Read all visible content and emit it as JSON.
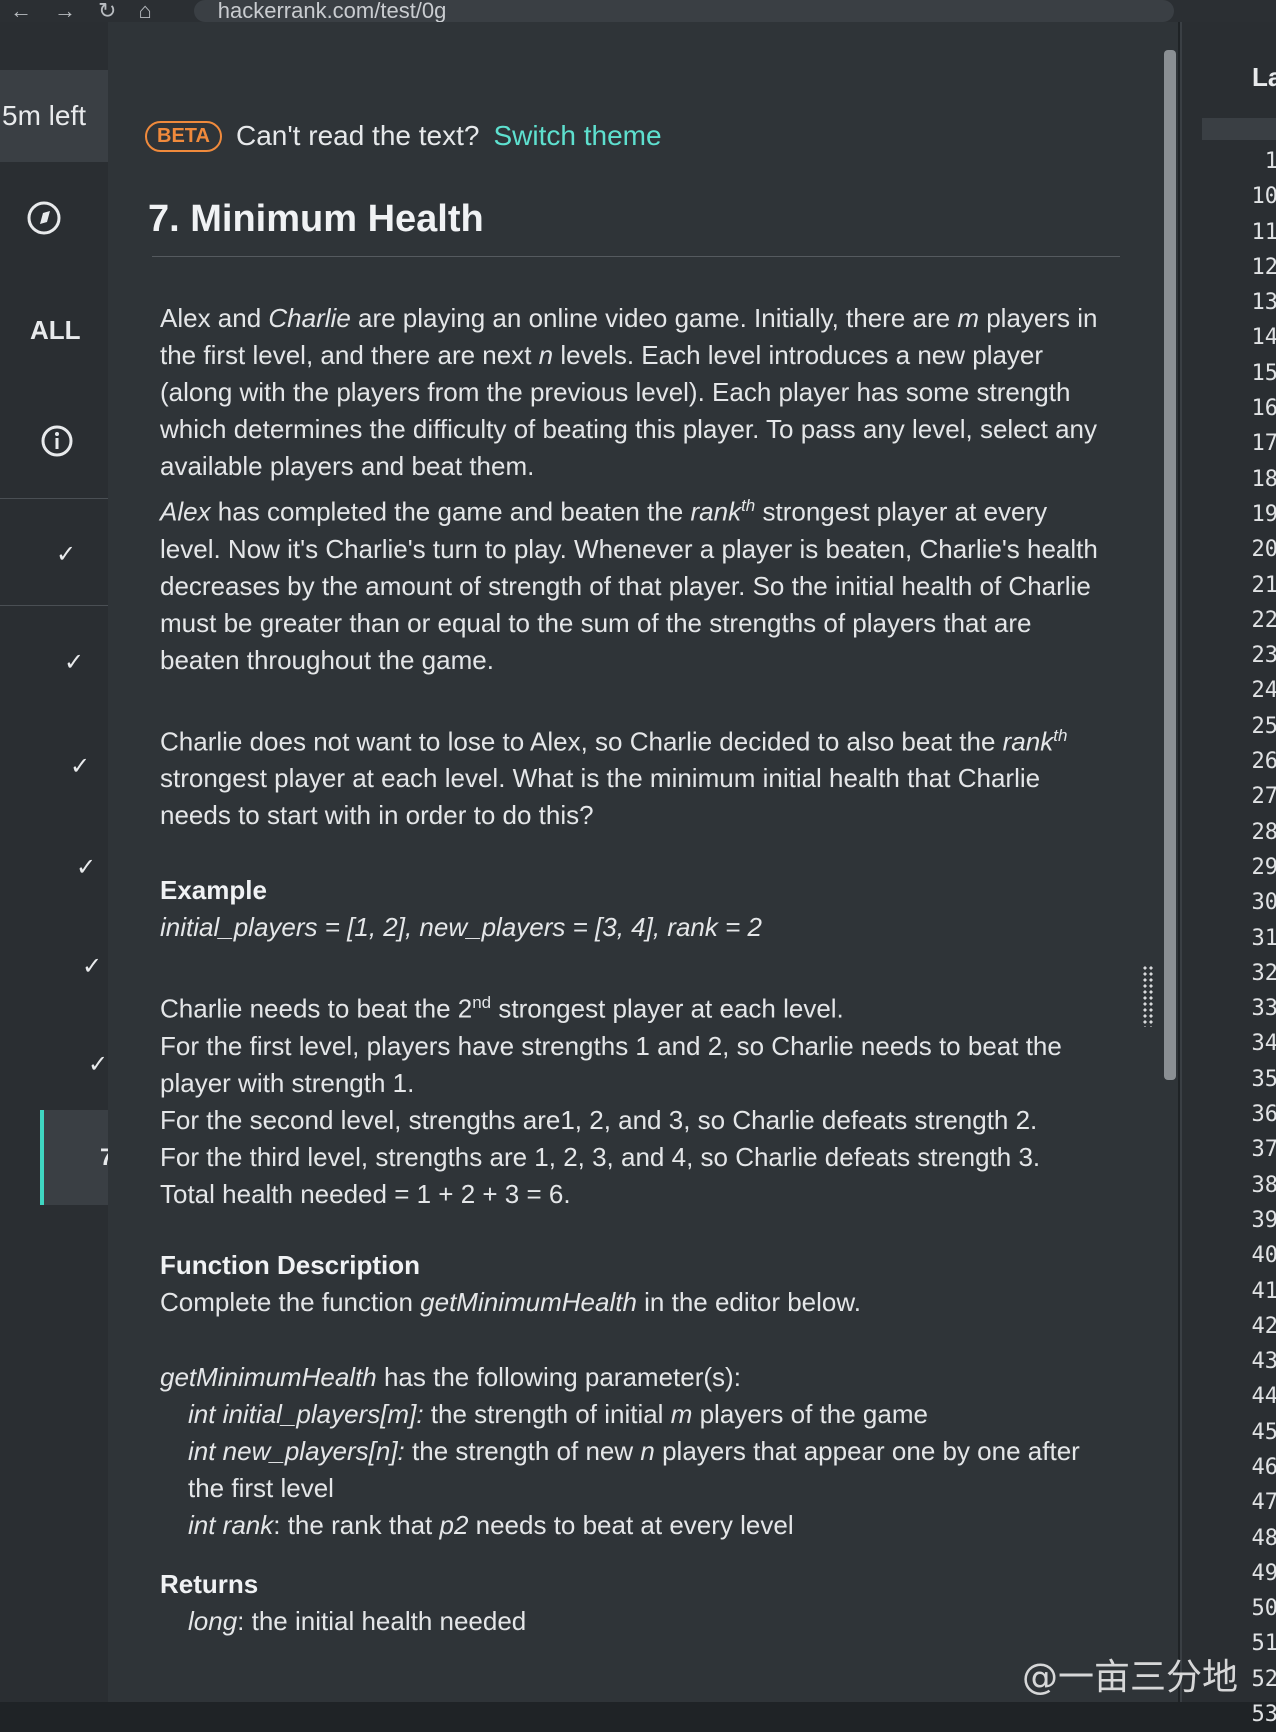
{
  "browser": {
    "url_fragment": "hackerrank.com/test/0g"
  },
  "nav": {
    "time_left": "5m left",
    "all_label": "ALL",
    "active_question": "7"
  },
  "banner": {
    "beta": "BETA",
    "prompt": "Can't read the text?",
    "switch_theme": "Switch theme"
  },
  "problem": {
    "title": "7. Minimum Health",
    "p1_a": "Alex and ",
    "p1_b": "Charlie",
    "p1_c": " are playing an online video game. Initially, there are ",
    "p1_m": "m",
    "p1_d": " players in the first level, and there are next ",
    "p1_n": "n",
    "p1_e": " levels. Each level introduces a new player (along with the players from the previous level). Each player has some strength which determines the difficulty of beating this player. To pass any level, select any available players and beat them.",
    "p2_alex": "Alex",
    "p2_a": " has completed the game and beaten the ",
    "p2_rank": "rank",
    "p2_th": "th",
    "p2_b": " strongest player at every level. Now it's Charlie's turn to play. Whenever a player is beaten, Charlie's health decreases by the amount of strength of that player. So the initial health of Charlie must be greater than or equal to the sum of the strengths of players that are beaten throughout the game.",
    "p3_a": "Charlie does not want to lose to Alex, so Charlie decided to also beat the ",
    "p3_rank": "rank",
    "p3_th": "th",
    "p3_b": " strongest player at each level. What is the minimum initial health that Charlie needs to start with in order to do this?",
    "example_head": "Example",
    "example_line": "initial_players = [1, 2], new_players = [3, 4], rank = 2",
    "ex1_a": "Charlie needs to beat the 2",
    "ex1_nd": "nd",
    "ex1_b": " strongest player at each level.",
    "ex2": "For the first level, players have strengths 1 and 2, so Charlie needs to beat the player with strength 1.",
    "ex3": "For the second level, strengths are1, 2, and 3, so Charlie defeats strength 2.",
    "ex4": "For the third level, strengths are 1, 2, 3, and 4, so Charlie defeats strength 3.",
    "ex5": "Total health needed = 1 + 2 + 3 = 6.",
    "func_head": "Function Description",
    "func_a": "Complete the function ",
    "func_name": "getMinimumHealth",
    "func_b": " in the editor below.",
    "params_name": "getMinimumHealth",
    "params_a": " has the following parameter(s):",
    "param1_sig": "int initial_players[m]:",
    "param1_a": "  the strength of initial ",
    "param1_m": "m",
    "param1_b": " players of the game",
    "param2_sig": "int new_players[n]:",
    "param2_a": "  the strength of new ",
    "param2_n": "n",
    "param2_b": " players that appear one by one after the first level",
    "param3_sig": "int rank",
    "param3_a": ": the rank that ",
    "param3_p2": "p2",
    "param3_b": " needs to beat at every level",
    "returns_head": "Returns",
    "returns_type": "long",
    "returns_desc": ": the initial health needed"
  },
  "editor": {
    "header_fragment": "La",
    "line_numbers": [
      "1",
      "10",
      "11",
      "12",
      "13",
      "14",
      "15",
      "16",
      "17",
      "18",
      "19",
      "20",
      "21",
      "22",
      "23",
      "24",
      "25",
      "26",
      "27",
      "28",
      "29",
      "30",
      "31",
      "32",
      "33",
      "34",
      "35",
      "36",
      "37",
      "38",
      "39",
      "40",
      "41",
      "42",
      "43",
      "44",
      "45",
      "46",
      "47",
      "48",
      "49",
      "50",
      "51",
      "52",
      "53"
    ]
  },
  "watermark": "@一亩三分地"
}
